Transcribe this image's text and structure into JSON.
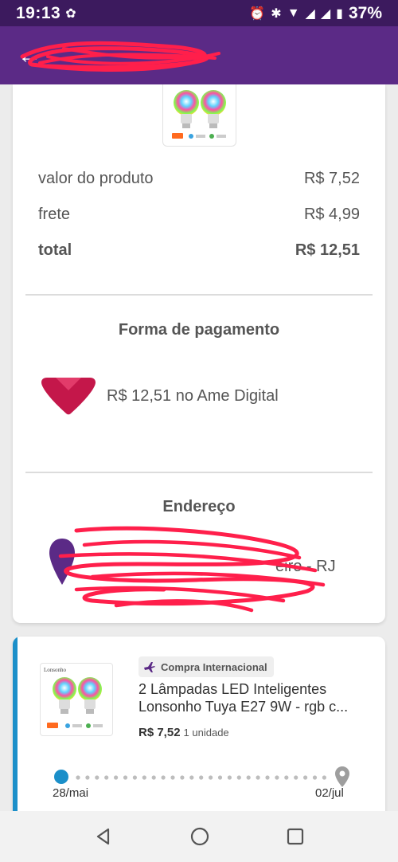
{
  "status_bar": {
    "time": "19:13",
    "battery": "37%"
  },
  "order_summary": {
    "product_value_label": "valor do produto",
    "product_value": "R$ 7,52",
    "shipping_label": "frete",
    "shipping_value": "R$ 4,99",
    "total_label": "total",
    "total_value": "R$ 12,51"
  },
  "payment": {
    "title": "Forma de pagamento",
    "text": "R$ 12,51 no Ame Digital"
  },
  "address": {
    "title": "Endereço",
    "visible_fragment": "eiro - RJ"
  },
  "order_item": {
    "tag": "Compra Internacional",
    "brand_on_box": "Lonsonho",
    "name": "2 Lâmpadas LED Inteligentes Lonsonho Tuya E27 9W - rgb c...",
    "price": "R$ 7,52",
    "quantity": "1 unidade",
    "timeline_start_date": "28/mai",
    "timeline_end_date": "02/jul"
  },
  "colors": {
    "status_bar": "#3c1a5e",
    "app_bar": "#5b2a86",
    "accent_blue": "#1b8fc9",
    "ame_red": "#c4174a",
    "redaction": "#ff1f4b"
  },
  "icons": [
    "back-arrow-icon",
    "plane-icon",
    "map-pin-icon",
    "nav-back-icon",
    "nav-home-icon",
    "nav-recents-icon"
  ]
}
